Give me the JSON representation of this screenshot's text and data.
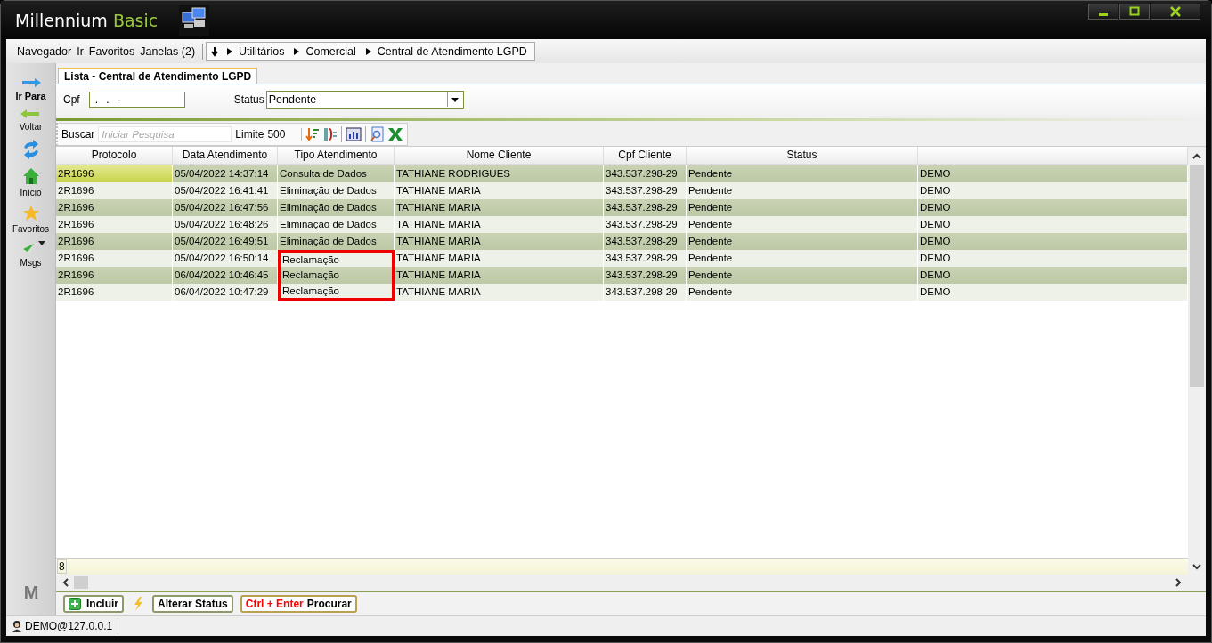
{
  "window": {
    "app_name": "Millennium",
    "edition": "Basic"
  },
  "menu": [
    {
      "label": "Navegador"
    },
    {
      "label": "Ir"
    },
    {
      "label": "Favoritos"
    },
    {
      "label": "Janelas (2)"
    }
  ],
  "breadcrumb": [
    "Utilitários",
    "Comercial",
    "Central de Atendimento LGPD"
  ],
  "sidebar": {
    "items": [
      {
        "kind": "forward",
        "label": "Ir Para"
      },
      {
        "kind": "back",
        "label": "Voltar"
      },
      {
        "kind": "refresh"
      },
      {
        "kind": "home",
        "label": "Início"
      },
      {
        "kind": "star",
        "label": "Favoritos"
      },
      {
        "kind": "messages",
        "label": "Msgs"
      }
    ],
    "logo_text": "M"
  },
  "tabs": [
    {
      "label": "Lista - Central de Atendimento LGPD",
      "selected": true
    }
  ],
  "filters": {
    "cpf": {
      "label": "Cpf",
      "value": ". . -"
    },
    "status": {
      "label": "Status",
      "value": "Pendente"
    }
  },
  "toolbar": {
    "search_label": "Buscar",
    "search_placeholder": "Iniciar Pesquisa",
    "limit_label": "Limite",
    "limit_value": "500"
  },
  "table": {
    "columns": [
      "Protocolo",
      "Data Atendimento",
      "Tipo Atendimento",
      "Nome Cliente",
      "Cpf Cliente",
      "Status"
    ],
    "rows": [
      {
        "selected": true,
        "highlighted": false,
        "cells": [
          "2R1696",
          "05/04/2022 14:37:14",
          "Consulta de Dados",
          "TATHIANE RODRIGUES",
          "343.537.298-29",
          "Pendente",
          "DEMO"
        ]
      },
      {
        "selected": false,
        "highlighted": false,
        "cells": [
          "2R1696",
          "05/04/2022 16:41:41",
          "Eliminação de Dados",
          "TATHIANE MARIA",
          "343.537.298-29",
          "Pendente",
          "DEMO"
        ]
      },
      {
        "selected": false,
        "highlighted": false,
        "cells": [
          "2R1696",
          "05/04/2022 16:47:56",
          "Eliminação de Dados",
          "TATHIANE MARIA",
          "343.537.298-29",
          "Pendente",
          "DEMO"
        ]
      },
      {
        "selected": false,
        "highlighted": false,
        "cells": [
          "2R1696",
          "05/04/2022 16:48:26",
          "Eliminação de Dados",
          "TATHIANE MARIA",
          "343.537.298-29",
          "Pendente",
          "DEMO"
        ]
      },
      {
        "selected": false,
        "highlighted": false,
        "cells": [
          "2R1696",
          "05/04/2022 16:49:51",
          "Eliminação de Dados",
          "TATHIANE MARIA",
          "343.537.298-29",
          "Pendente",
          "DEMO"
        ]
      },
      {
        "selected": false,
        "highlighted": true,
        "cells": [
          "2R1696",
          "05/04/2022 16:50:14",
          "Reclamação",
          "TATHIANE MARIA",
          "343.537.298-29",
          "Pendente",
          "DEMO"
        ]
      },
      {
        "selected": false,
        "highlighted": true,
        "cells": [
          "2R1696",
          "06/04/2022 10:46:45",
          "Reclamação",
          "TATHIANE MARIA",
          "343.537.298-29",
          "Pendente",
          "DEMO"
        ]
      },
      {
        "selected": false,
        "highlighted": true,
        "cells": [
          "2R1696",
          "06/04/2022 10:47:29",
          "Reclamação",
          "TATHIANE MARIA",
          "343.537.298-29",
          "Pendente",
          "DEMO"
        ]
      }
    ],
    "row_count": "8"
  },
  "actions": [
    {
      "kind": "add",
      "label": "Incluir"
    },
    {
      "kind": "lightning"
    },
    {
      "kind": "plain",
      "label": "Alterar Status"
    },
    {
      "kind": "shortcut",
      "shortcut": "Ctrl + Enter",
      "label": "Procurar"
    }
  ],
  "status_bar": {
    "user": "DEMO@127.0.0.1"
  }
}
